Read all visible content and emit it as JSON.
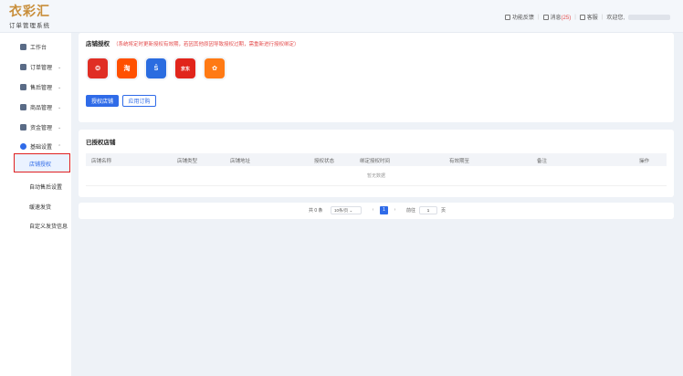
{
  "logo": {
    "main": "衣彩汇",
    "sub": "订单管理系统"
  },
  "topbar": {
    "feedback": "功能反馈",
    "message_label": "消息",
    "message_count": "(25)",
    "service": "客服",
    "welcome": "欢迎您,"
  },
  "sidebar": {
    "items": [
      {
        "label": "工作台"
      },
      {
        "label": "订单管理"
      },
      {
        "label": "售后管理"
      },
      {
        "label": "商品管理"
      },
      {
        "label": "资金管理"
      },
      {
        "label": "基础设置"
      }
    ],
    "sub_items": [
      {
        "label": "店铺授权"
      },
      {
        "label": "自动售后设置"
      },
      {
        "label": "缓速发货"
      },
      {
        "label": "自定义发货信息"
      }
    ]
  },
  "auth_card": {
    "title": "店铺授权",
    "note": "（系统将定时更新授权有效期，若因其他原因导致授权过期，需重新进行授权绑定）",
    "shops": [
      {
        "name": "pinduoduo-icon",
        "color": "#e02e24",
        "glyph": "❂"
      },
      {
        "name": "taobao-icon",
        "color": "#ff5000",
        "glyph": "淘"
      },
      {
        "name": "kuaishou-icon",
        "color": "#2a6ce0",
        "glyph": "Ŝ"
      },
      {
        "name": "jd-icon",
        "color": "#e1251b",
        "glyph": "京东"
      },
      {
        "name": "multi-store-icon",
        "color": "#ff7a14",
        "glyph": "✿"
      }
    ],
    "authorize_button": "授权店铺",
    "buy_button": "应用订购"
  },
  "authorized_card": {
    "title": "已授权店铺",
    "columns": [
      "店铺名称",
      "店铺类型",
      "店铺地址",
      "授权状态",
      "绑定授权时间",
      "有效期至",
      "备注",
      "操作"
    ],
    "empty_text": "暂无数据"
  },
  "pagination": {
    "total": "共 0 条",
    "page_size": "10条/页",
    "current_page": "1",
    "goto_label": "前往",
    "goto_value": "1",
    "page_suffix": "页"
  }
}
